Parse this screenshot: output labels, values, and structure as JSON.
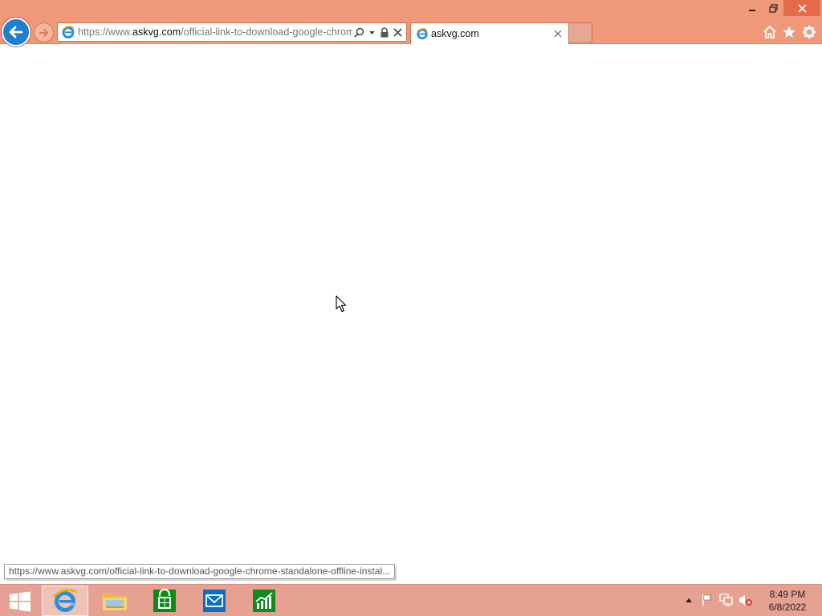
{
  "browser": {
    "address_bar": {
      "url_prefix": "https://www.",
      "url_host": "askvg.com",
      "url_path": "/official-link-to-download-google-chrome"
    },
    "tab": {
      "title": "askvg.com"
    },
    "status_url": "https://www.askvg.com/official-link-to-download-google-chrome-standalone-offline-instal..."
  },
  "taskbar": {
    "apps": [
      {
        "name": "Internet Explorer",
        "icon": "ie-icon",
        "active": true
      },
      {
        "name": "File Explorer",
        "icon": "folder-icon",
        "active": false
      },
      {
        "name": "Store",
        "icon": "store-icon",
        "active": false
      },
      {
        "name": "Mail",
        "icon": "mail-icon",
        "active": false
      },
      {
        "name": "Finance",
        "icon": "finance-icon",
        "active": false
      }
    ],
    "clock": {
      "time": "8:49 PM",
      "date": "6/8/2022"
    }
  },
  "colors": {
    "chrome_bg": "#f0987a",
    "taskbar_bg": "#e7a192",
    "back_button": "#1e7fd0"
  }
}
